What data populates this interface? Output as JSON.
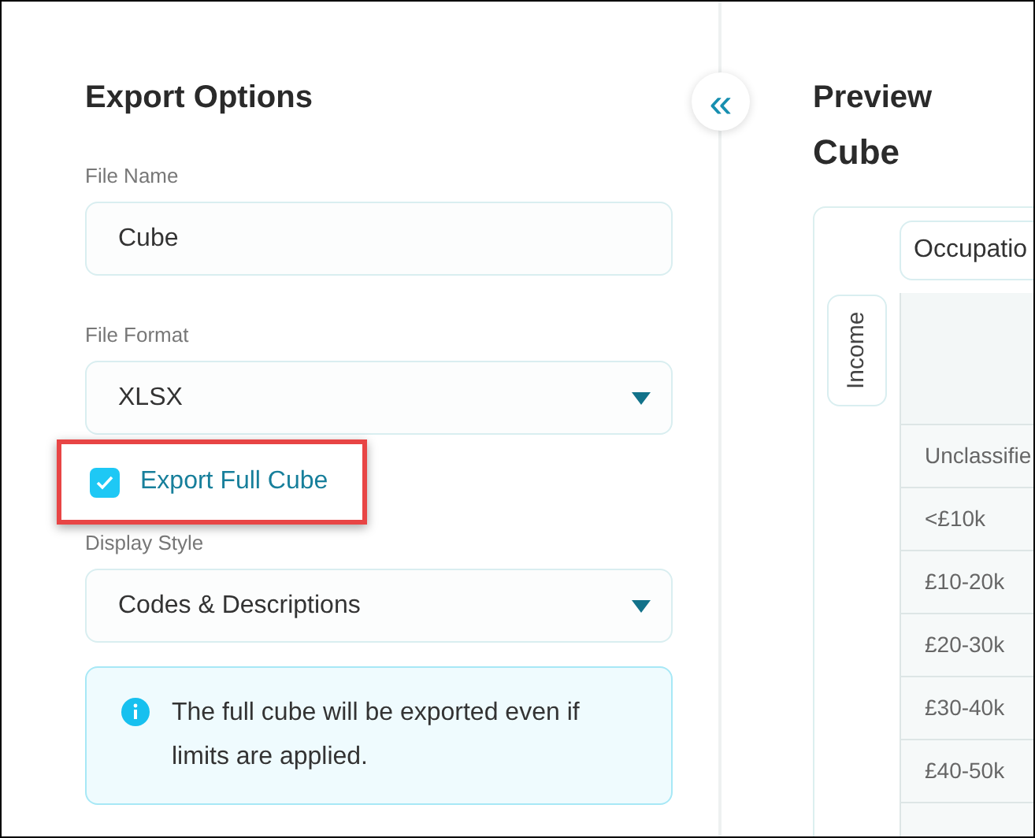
{
  "export_options": {
    "title": "Export Options",
    "collapse_button": "«",
    "fields": [
      {
        "kind": "text",
        "label": "File Name",
        "value": "Cube"
      },
      {
        "kind": "select",
        "label": "File Format",
        "value": "XLSX"
      },
      {
        "kind": "checkbox",
        "label": "Export Full Cube",
        "checked": true,
        "highlighted": true
      },
      {
        "kind": "select",
        "label": "Display Style",
        "value": "Codes & Descriptions"
      }
    ],
    "info": "The full cube will be exported even if limits are applied."
  },
  "preview": {
    "title": "Preview",
    "cube_title": "Cube",
    "column_dimension": "Occupatio",
    "row_dimension": "Income",
    "row_labels": [
      "Unclassifie",
      "<£10k",
      "£10-20k",
      "£20-30k",
      "£30-40k",
      "£40-50k"
    ]
  }
}
